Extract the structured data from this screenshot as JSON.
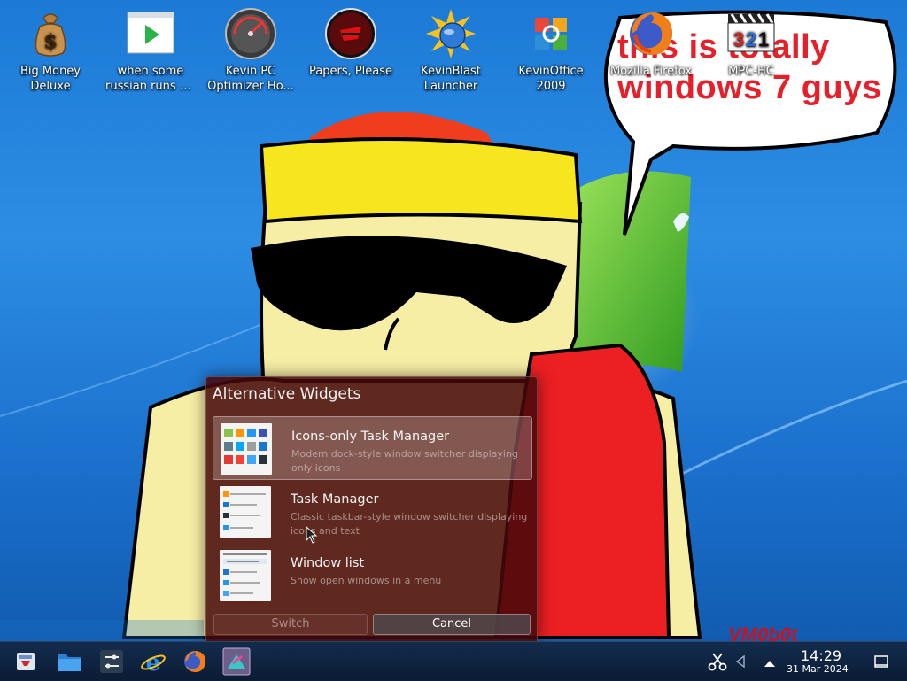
{
  "desktop": {
    "icons": [
      {
        "label": "Big Money Deluxe",
        "line1": "Big Money",
        "line2": "Deluxe",
        "icon": "money-bag-icon"
      },
      {
        "label": "when some russian runs a...",
        "line1": "when some",
        "line2": "russian runs a...",
        "icon": "video-file-icon"
      },
      {
        "label": "Kevin PC Optimizer Ho...",
        "line1": "Kevin PC",
        "line2": "Optimizer Ho...",
        "icon": "speedometer-icon"
      },
      {
        "label": "Papers, Please",
        "line1": "Papers, Please",
        "line2": "",
        "icon": "papers-please-icon"
      },
      {
        "label": "KevinBlast Launcher",
        "line1": "KevinBlast",
        "line2": "Launcher",
        "icon": "kevinblast-icon"
      },
      {
        "label": "KevinOffice 2009",
        "line1": "KevinOffice",
        "line2": "2009",
        "icon": "office-icon"
      },
      {
        "label": "Mozilla Firefox",
        "line1": "Mozilla Firefox",
        "line2": "",
        "icon": "firefox-icon"
      },
      {
        "label": "MPC-HC",
        "line1": "MPC-HC",
        "line2": "",
        "icon": "mpc-hc-icon"
      }
    ],
    "speech_bubble": {
      "line1": "this is totally",
      "line2": "windows 7 guys"
    },
    "signature": "VM0b0t"
  },
  "dialog": {
    "title": "Alternative Widgets",
    "items": [
      {
        "name": "Icons-only Task Manager",
        "description": "Modern dock-style window switcher displaying only icons",
        "selected": true
      },
      {
        "name": "Task Manager",
        "description": "Classic taskbar-style window switcher displaying icons and text",
        "selected": false
      },
      {
        "name": "Window list",
        "description": "Show open windows in a menu",
        "selected": false
      }
    ],
    "switch_label": "Switch",
    "cancel_label": "Cancel"
  },
  "taskbar": {
    "launchers": [
      "app-launcher-icon",
      "file-manager-icon",
      "system-settings-icon",
      "internet-explorer-icon",
      "firefox-icon",
      "discover-icon"
    ],
    "clock_time": "14:29",
    "clock_date": "31 Mar 2024"
  },
  "colors": {
    "speech_text": "#e5202a",
    "dialog_bg": "#460810",
    "wallpaper_blue": "#1c7ad6"
  }
}
